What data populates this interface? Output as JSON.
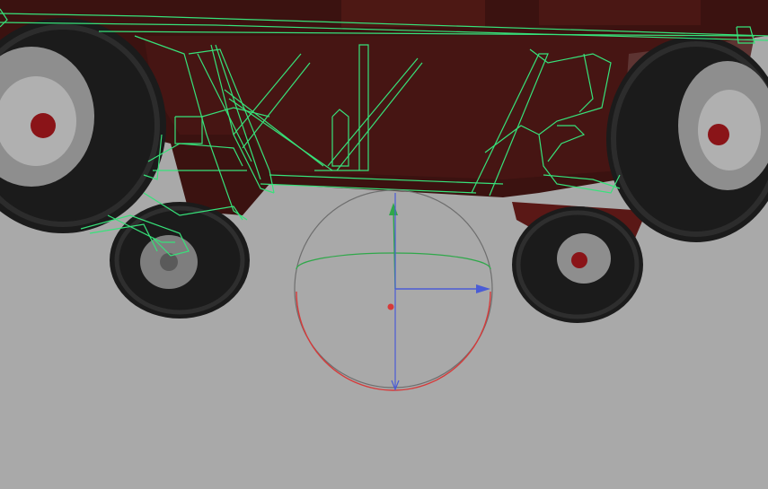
{
  "viewport": {
    "background": "#a9a9a9",
    "selection_wireframe_color": "#37e27a",
    "chassis_color": "#3b1210",
    "tire_color": "#1b1b1b",
    "rim_color": "#9a9a9a",
    "hub_color": "#8a1418"
  },
  "gizmo": {
    "type": "rotate-manipulator",
    "x_axis_color": "#4a5cd6",
    "y_axis_color": "#2fa84a",
    "z_axis_color": "#d63a3a",
    "sphere_outline_color": "#6e6e6e",
    "pivot_color": "#d63a3a"
  }
}
